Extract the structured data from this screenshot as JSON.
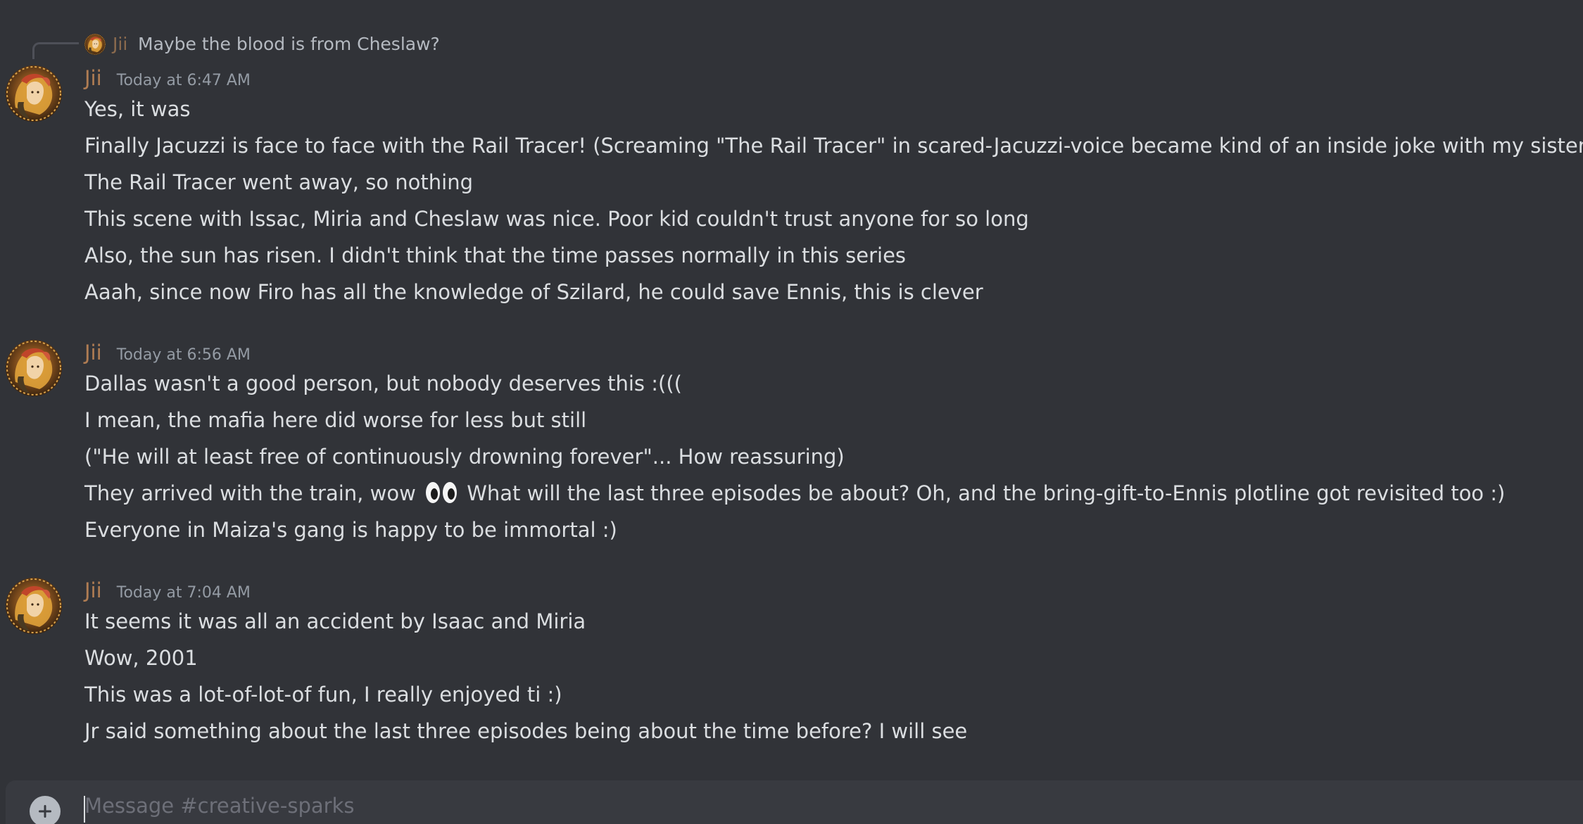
{
  "reply": {
    "username": "Jii",
    "text": "Maybe the blood is from Cheslaw?"
  },
  "messages": [
    {
      "username": "Jii",
      "timestamp": "Today at 6:47 AM",
      "lines": [
        "Yes, it was",
        "Finally Jacuzzi is face to face with the Rail Tracer! (Screaming \"The Rail Tracer\" in scared-Jacuzzi-voice became kind of an inside joke with my sister)",
        "The Rail Tracer went away, so nothing",
        "This scene with Issac, Miria and Cheslaw was nice. Poor kid couldn't trust anyone for so long",
        "Also, the sun has risen. I didn't think that the time passes normally in this series",
        "Aaah, since now Firo has all the knowledge of Szilard, he could save Ennis, this is clever"
      ]
    },
    {
      "username": "Jii",
      "timestamp": "Today at 6:56 AM",
      "lines": [
        "Dallas wasn't a good person, but nobody deserves this :(((",
        "I mean, the mafia here did worse for less but still",
        "(\"He will at least free of continuously drowning forever\"... How reassuring)",
        "They arrived with the train, wow",
        "What will the last three episodes be about? Oh, and the bring-gift-to-Ennis plotline got revisited too :)",
        "Everyone in Maiza's gang is happy to be immortal :)"
      ]
    },
    {
      "username": "Jii",
      "timestamp": "Today at 7:04 AM",
      "lines": [
        "It seems it was all an accident by Isaac and Miria",
        "Wow, 2001",
        "This was a lot-of-lot-of fun, I really enjoyed ti :)",
        "Jr said something about the last three episodes being about the time before? I will see"
      ]
    }
  ],
  "composer": {
    "placeholder": "Message #creative-sparks"
  },
  "colors": {
    "background": "#313338",
    "username": "#b07d53",
    "timestamp": "#949ba4",
    "text": "#dbdee1",
    "composer_bg": "#383a40"
  },
  "icons": {
    "attach": "plus-circle-icon",
    "eyes": "eyes-emoji"
  }
}
